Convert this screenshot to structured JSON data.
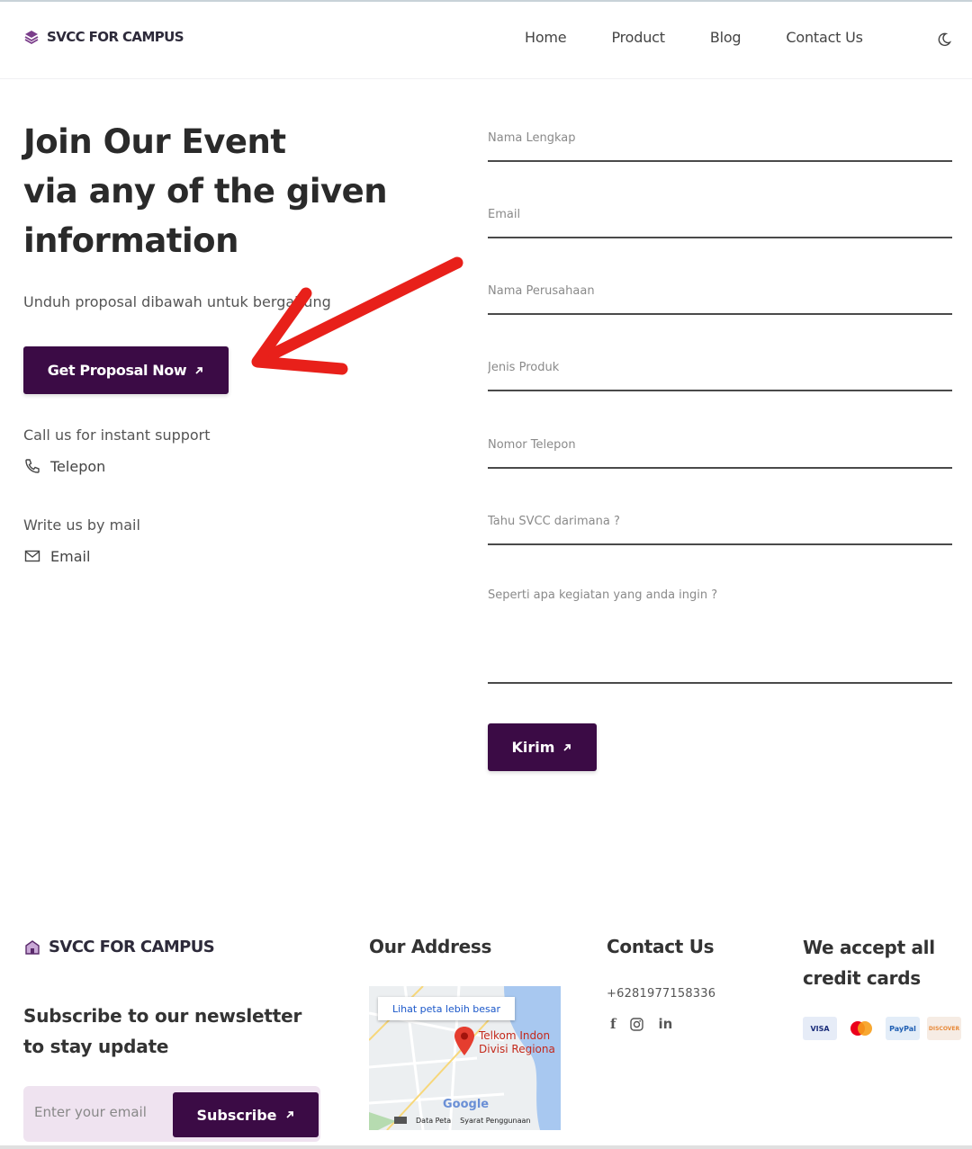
{
  "nav": {
    "brand": "SVCC FOR CAMPUS",
    "links": [
      "Home",
      "Product",
      "Blog",
      "Contact Us"
    ],
    "theme_toggle_icon": "moon-icon"
  },
  "hero": {
    "title_line1": "Join Our Event",
    "title_line2": "via any of the given",
    "title_line3": "information",
    "subtitle": "Unduh proposal dibawah untuk bergabung",
    "cta_label": "Get Proposal Now",
    "support_label": "Call us for instant support",
    "phone_label": "Telepon",
    "mail_label": "Write us by mail",
    "email_label": "Email"
  },
  "form": {
    "fields": [
      {
        "placeholder": "Nama Lengkap"
      },
      {
        "placeholder": "Email"
      },
      {
        "placeholder": "Nama Perusahaan"
      },
      {
        "placeholder": "Jenis Produk"
      },
      {
        "placeholder": "Nomor Telepon"
      },
      {
        "placeholder": "Tahu SVCC darimana ?"
      }
    ],
    "message_placeholder": "Seperti apa kegiatan yang anda ingin ?",
    "submit_label": "Kirim"
  },
  "footer": {
    "brand": "SVCC FOR CAMPUS",
    "newsletter_text": "Subscribe to our newsletter to stay update",
    "email_placeholder": "Enter your email",
    "subscribe_label": "Subscribe",
    "address_heading": "Our Address",
    "map": {
      "link_label": "Lihat peta lebih besar",
      "place_line1": "Telkom Indon",
      "place_line2": "Divisi Regiona",
      "google_label": "Google",
      "data_label": "Data Peta",
      "terms_label": "Syarat Penggunaan"
    },
    "contact_heading": "Contact Us",
    "phone": "+6281977158336",
    "socials": [
      "facebook-icon",
      "instagram-icon",
      "linkedin-icon"
    ],
    "cards_heading": "We accept all credit cards",
    "cards": [
      "VISA",
      "mastercard",
      "PayPal",
      "DISCOVER"
    ]
  },
  "colors": {
    "primary": "#3b0b45",
    "annotation_arrow": "#e8201a",
    "subscribe_bg": "#efe3f0"
  }
}
